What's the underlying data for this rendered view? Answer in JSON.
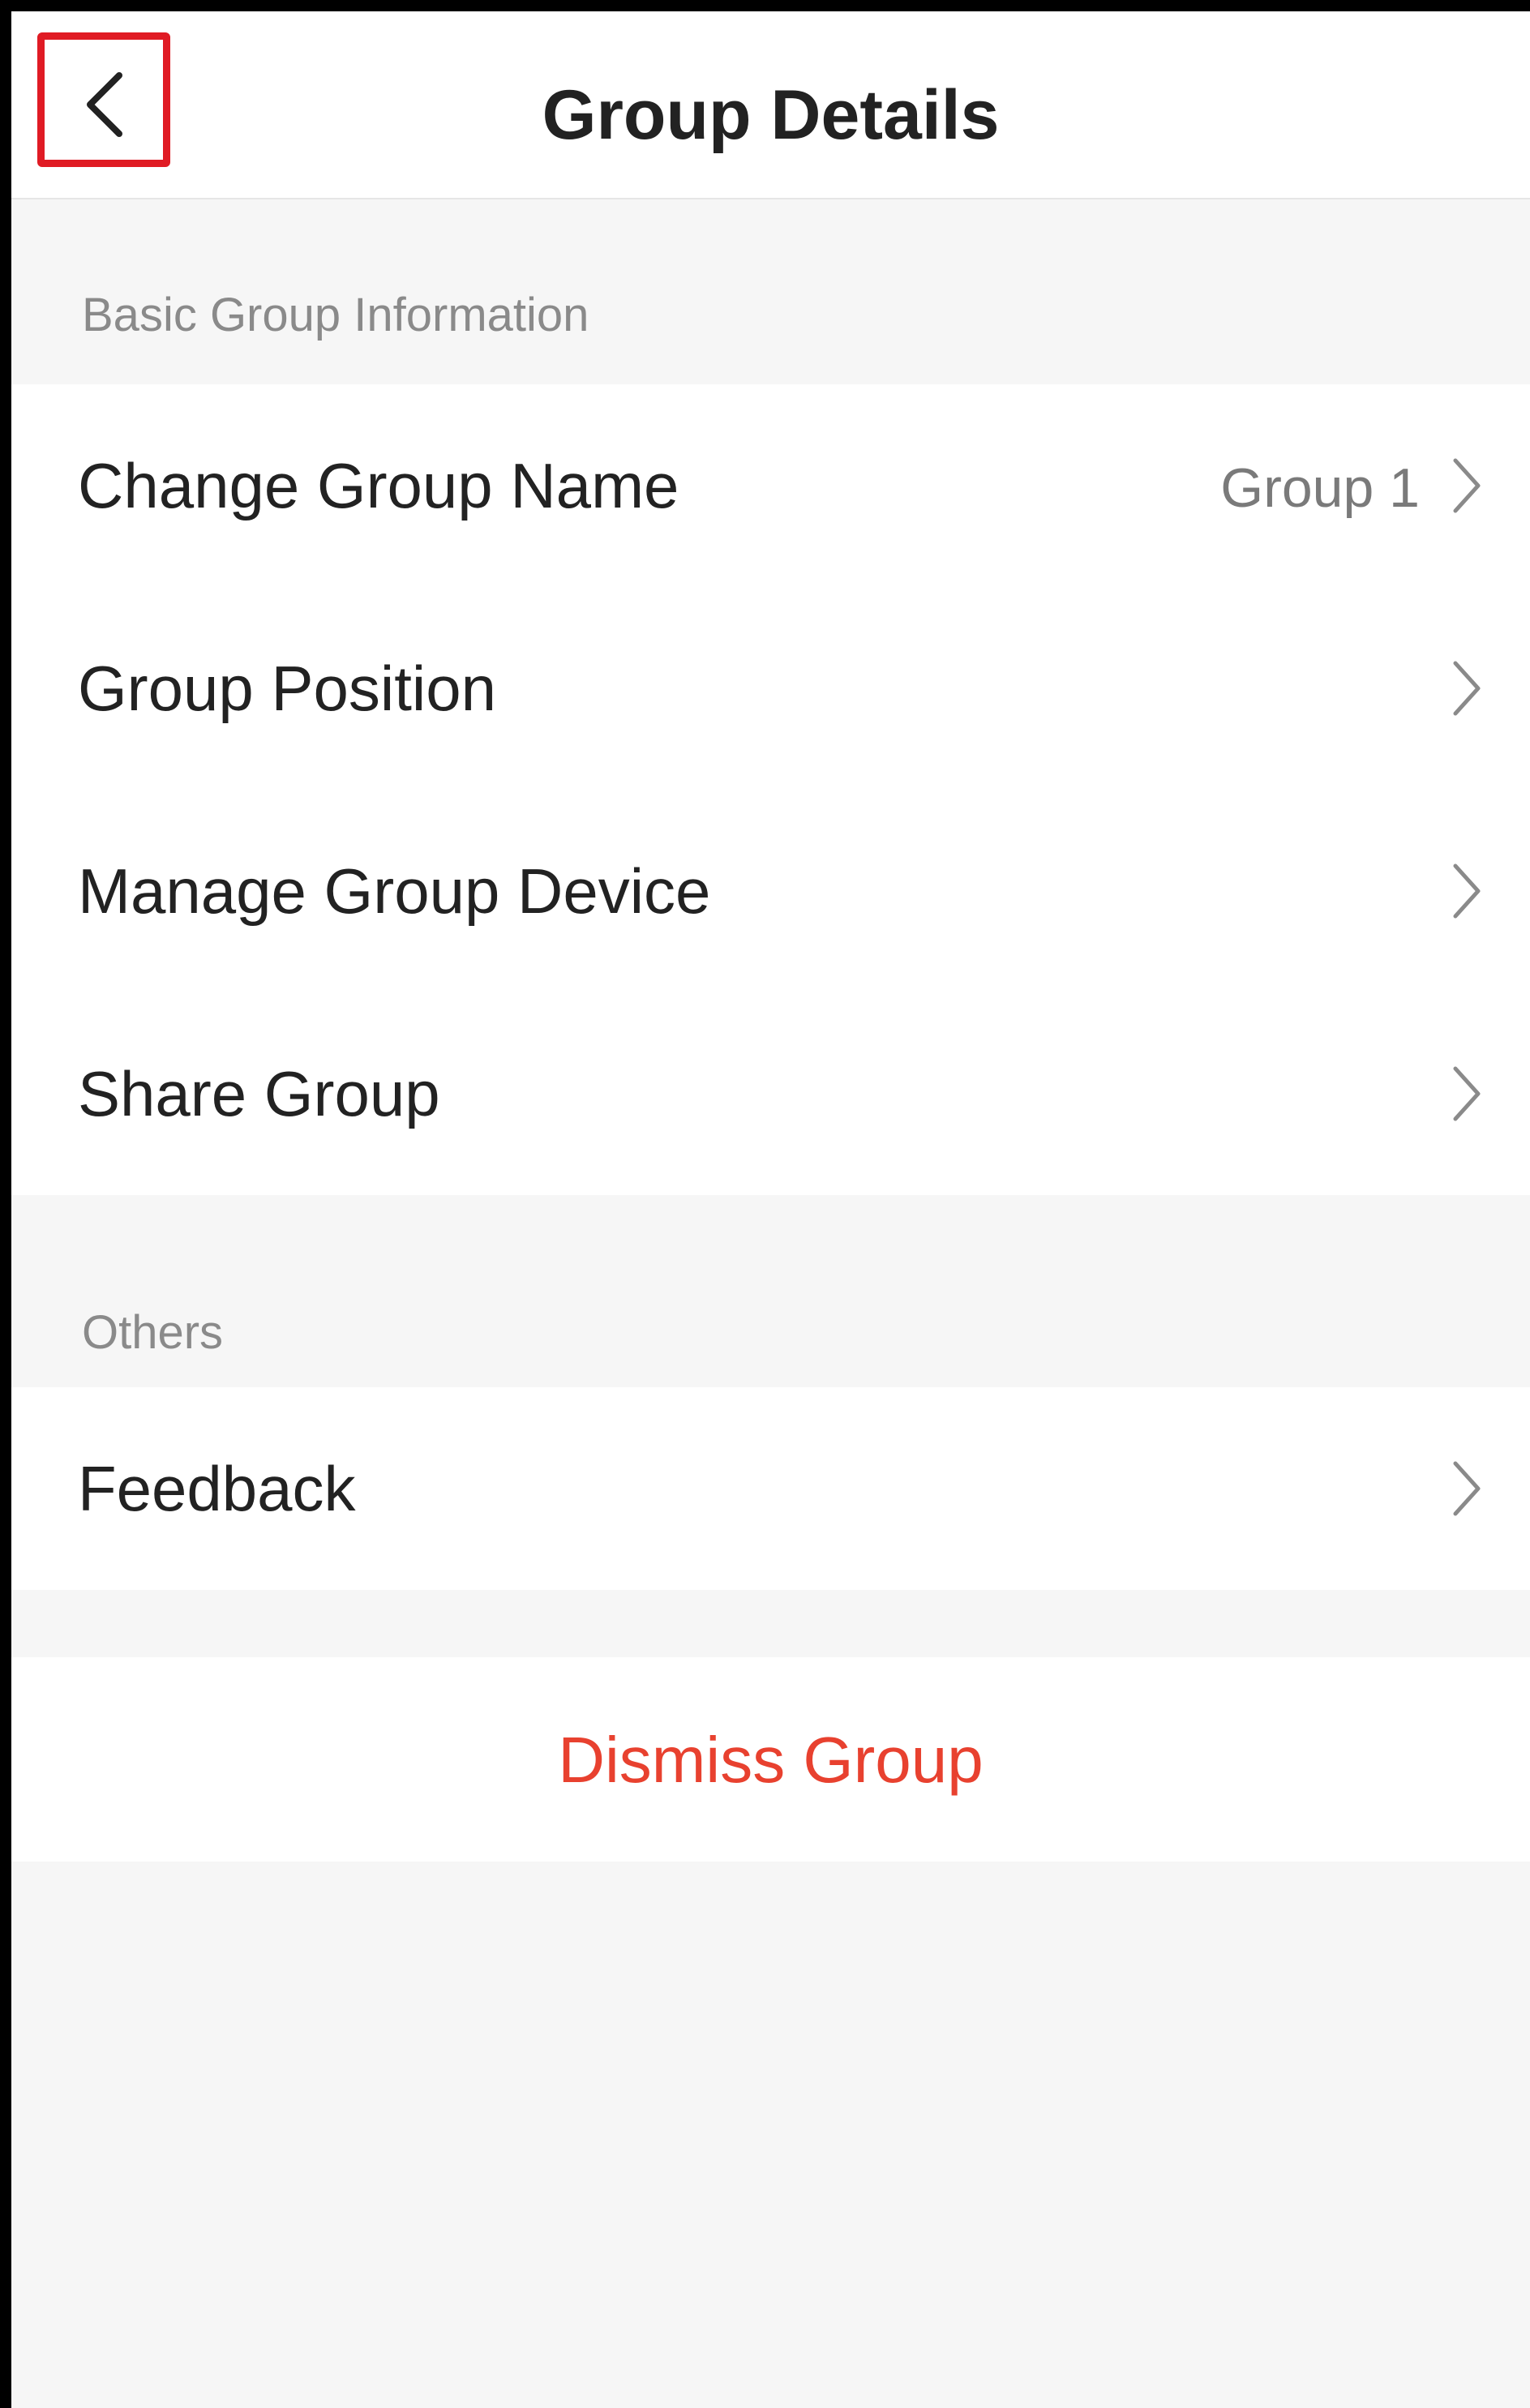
{
  "header": {
    "title": "Group Details",
    "back_icon": "chevron-left-icon"
  },
  "sections": {
    "basic": {
      "title": "Basic Group Information",
      "items": [
        {
          "label": "Change Group Name",
          "value": "Group 1",
          "icon": "chevron-right-icon"
        },
        {
          "label": "Group Position",
          "value": "",
          "icon": "chevron-right-icon"
        },
        {
          "label": "Manage Group Device",
          "value": "",
          "icon": "chevron-right-icon"
        },
        {
          "label": "Share Group",
          "value": "",
          "icon": "chevron-right-icon"
        }
      ]
    },
    "others": {
      "title": "Others",
      "items": [
        {
          "label": "Feedback",
          "icon": "chevron-right-icon"
        }
      ]
    }
  },
  "dismiss": {
    "label": "Dismiss Group"
  },
  "colors": {
    "highlight": "#e01b24",
    "danger_text": "#e8412f",
    "page_background": "#f6f6f6",
    "card_background": "#ffffff"
  }
}
